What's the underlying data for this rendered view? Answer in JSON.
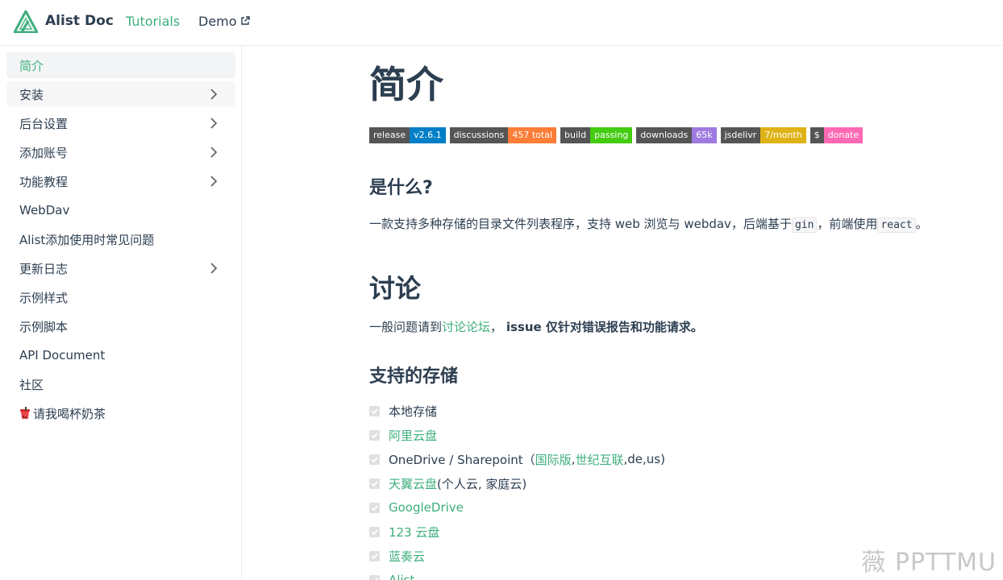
{
  "navbar": {
    "site_name": "Alist Doc",
    "tutorials_label": "Tutorials",
    "demo_label": "Demo"
  },
  "sidebar": {
    "items": [
      {
        "label": "简介",
        "active": true,
        "has_chevron": false
      },
      {
        "label": "安装",
        "has_chevron": true
      },
      {
        "label": "后台设置",
        "has_chevron": true
      },
      {
        "label": "添加账号",
        "has_chevron": true
      },
      {
        "label": "功能教程",
        "has_chevron": true
      },
      {
        "label": "WebDav",
        "has_chevron": false
      },
      {
        "label": "Alist添加使用时常见问题",
        "has_chevron": false
      },
      {
        "label": "更新日志",
        "has_chevron": true
      },
      {
        "label": "示例样式",
        "has_chevron": false
      },
      {
        "label": "示例脚本",
        "has_chevron": false
      },
      {
        "label": "API Document",
        "has_chevron": false
      },
      {
        "label": "社区",
        "has_chevron": false
      },
      {
        "label": "请我喝杯奶茶",
        "has_chevron": false
      }
    ]
  },
  "content": {
    "title": "简介",
    "badges": [
      {
        "left": "release",
        "right": "v2.6.1",
        "color": "#007ec6"
      },
      {
        "left": "discussions",
        "right": "457 total",
        "color": "#fe7d37"
      },
      {
        "left": "build",
        "right": "passing",
        "color": "#4c1"
      },
      {
        "left": "downloads",
        "right": "65k",
        "color": "#9f7be1"
      },
      {
        "left": "jsdelivr",
        "right": "7/month",
        "color": "#dfb317"
      },
      {
        "left": "$",
        "right": "donate",
        "color": "#ff69b4"
      }
    ],
    "what_heading": "是什么?",
    "what_text_1": "一款支持多种存储的目录文件列表程序，支持 web 浏览与 webdav，后端基于",
    "what_code_1": "gin",
    "what_text_2": "，前端使用",
    "what_code_2": "react",
    "what_text_3": "。",
    "discuss_heading": "讨论",
    "discuss_text_1": "一般问题请到",
    "discuss_link": "讨论论坛",
    "discuss_text_2": "，",
    "discuss_strong": "issue 仅针对错误报告和功能请求。",
    "storage_heading": "支持的存储",
    "storage": {
      "local": "本地存储",
      "aliyun": "阿里云盘",
      "onedrive_prefix": "OneDrive / Sharepoint（",
      "onedrive_link1": "国际版",
      "onedrive_sep": ", ",
      "onedrive_link2": "世纪互联",
      "onedrive_suffix": ",de,us)",
      "tianyi_link": "天翼云盘",
      "tianyi_suffix": " (个人云, 家庭云)",
      "googledrive": "GoogleDrive",
      "yun123": "123 云盘",
      "lanzou": "蓝奏云",
      "alist": "Alist"
    }
  },
  "watermark": "薇 PPTTMU",
  "colors": {
    "accent": "#3eaf7c",
    "text": "#2c3e50",
    "border": "#eaecef"
  }
}
